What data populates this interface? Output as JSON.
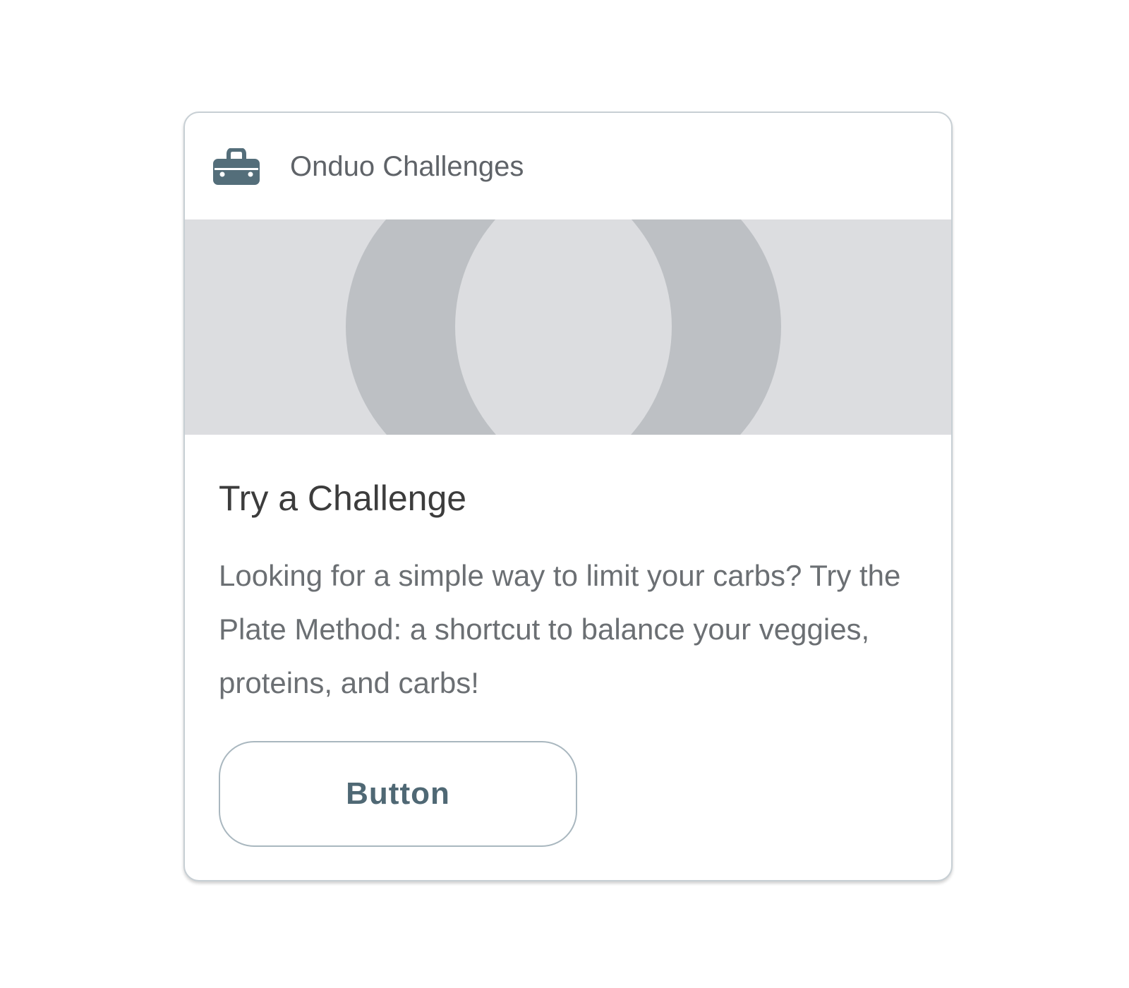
{
  "card": {
    "header": {
      "icon": "toolbox-icon",
      "title": "Onduo Challenges"
    },
    "hero": {
      "background_color": "#dcdde0",
      "shape_color": "#bdc0c4"
    },
    "title": "Try a Challenge",
    "body": "Looking for a simple way to limit your carbs? Try the Plate Method: a shortcut to balance your veggies, proteins, and carbs!",
    "button_label": "Button"
  },
  "colors": {
    "accent": "#4f6874",
    "border": "#c7cfd4"
  }
}
